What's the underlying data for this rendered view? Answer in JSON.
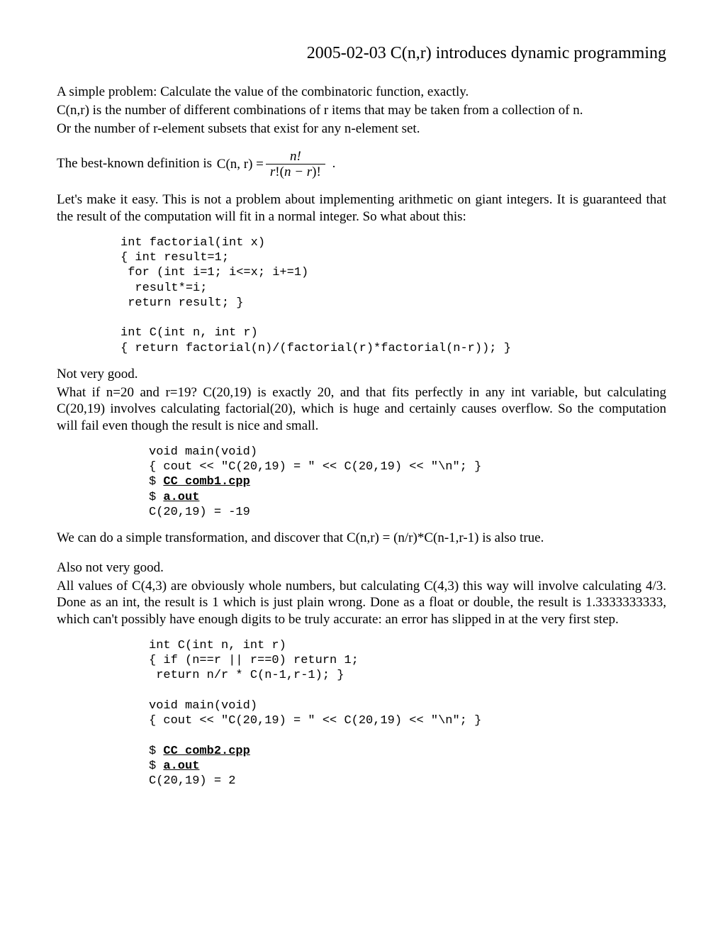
{
  "title": "2005-02-03  C(n,r) introduces dynamic programming",
  "intro": {
    "l1": "A simple problem: Calculate the value of the combinatoric function, exactly.",
    "l2": "C(n,r) is the number of different combinations of r items that may be taken from a collection of n.",
    "l3": "Or the number of r-element subsets that exist for any n-element set.",
    "def_lead": "The best-known definition is ",
    "def_tail": "."
  },
  "formula": {
    "lhs_C": "C",
    "lhs_args": "(n, r) = ",
    "num": "n!",
    "den_l": "r",
    "den_bang1": "!(",
    "den_mid": "n − r",
    "den_bang2": ")!"
  },
  "p2": "Let's make it easy. This is not a problem about implementing arithmetic on giant integers. It is guaranteed that the result of the computation will fit in a normal integer. So what about this:",
  "code1": "int factorial(int x)\n{ int result=1;\n for (int i=1; i<=x; i+=1)\n  result*=i;\n return result; }\n\nint C(int n, int r)\n{ return factorial(n)/(factorial(r)*factorial(n-r)); }",
  "p3": "Not very good.",
  "p4": "What if n=20 and r=19?  C(20,19) is exactly 20, and that fits perfectly in any int variable, but calculating C(20,19) involves calculating factorial(20), which is huge and certainly causes overflow. So the computation will fail even though the result is nice and small.",
  "code2": {
    "l1": "void main(void)",
    "l2": "{ cout << \"C(20,19) = \" << C(20,19) << \"\\n\"; }",
    "l3a": "$ ",
    "l3b": "CC comb1.cpp",
    "l4a": "$ ",
    "l4b": "a.out",
    "l5": "C(20,19) = -19"
  },
  "p5": "We can do a simple transformation, and discover that C(n,r) = (n/r)*C(n-1,r-1) is also true.",
  "p6": "Also not very good.",
  "p7": "All values of C(4,3) are obviously whole numbers, but calculating C(4,3) this way will involve calculating 4/3. Done as an int, the result is 1 which is just plain wrong. Done as a float or double, the result is 1.3333333333, which can't possibly have enough digits to be truly accurate: an error has slipped in at the very first step.",
  "code3": {
    "l1": "int C(int n, int r)",
    "l2": "{ if (n==r || r==0) return 1;",
    "l3": " return n/r * C(n-1,r-1); }",
    "l4": "",
    "l5": "void main(void)",
    "l6": "{ cout << \"C(20,19) = \" << C(20,19) << \"\\n\"; }",
    "l7": "",
    "l8a": "$ ",
    "l8b": "CC comb2.cpp",
    "l9a": "$ ",
    "l9b": "a.out",
    "l10": "C(20,19) = 2"
  }
}
